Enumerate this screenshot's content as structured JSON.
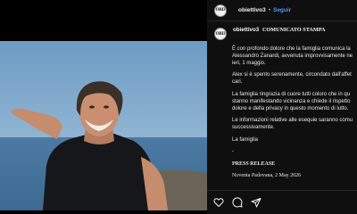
{
  "post": {
    "username": "obiettivo3",
    "separator": "•",
    "follow_label": "Seguir",
    "avatar_text": "OBI3"
  },
  "caption": {
    "username": "obiettivo3",
    "title": "COMUNICATO STAMPA",
    "paragraphs": [
      [
        "È con profondo dolore che la famiglia comunica la",
        "Alessandro Zanardi, avvenuta improvvisamente ne",
        "ieri, 1 maggio."
      ],
      [
        "Alex si è spento serenamente, circondato dall'affet",
        "cari."
      ],
      [
        "La famiglia ringrazia di cuore tutti coloro che in qu",
        "stanno manifestando vicinanza e chiede il rispetto",
        "dolore e della privacy in questo momento di lutto."
      ],
      [
        "Le informazioni relative alle esequie saranno comu",
        "successivamente."
      ],
      [
        "La famiglia"
      ],
      [
        "-"
      ]
    ],
    "press_release": "PRESS RELEASE",
    "date_line": "Noventa Padovana, 2 May 2026"
  },
  "actions": {
    "icons": [
      "heart-icon",
      "comment-icon",
      "share-icon"
    ]
  }
}
